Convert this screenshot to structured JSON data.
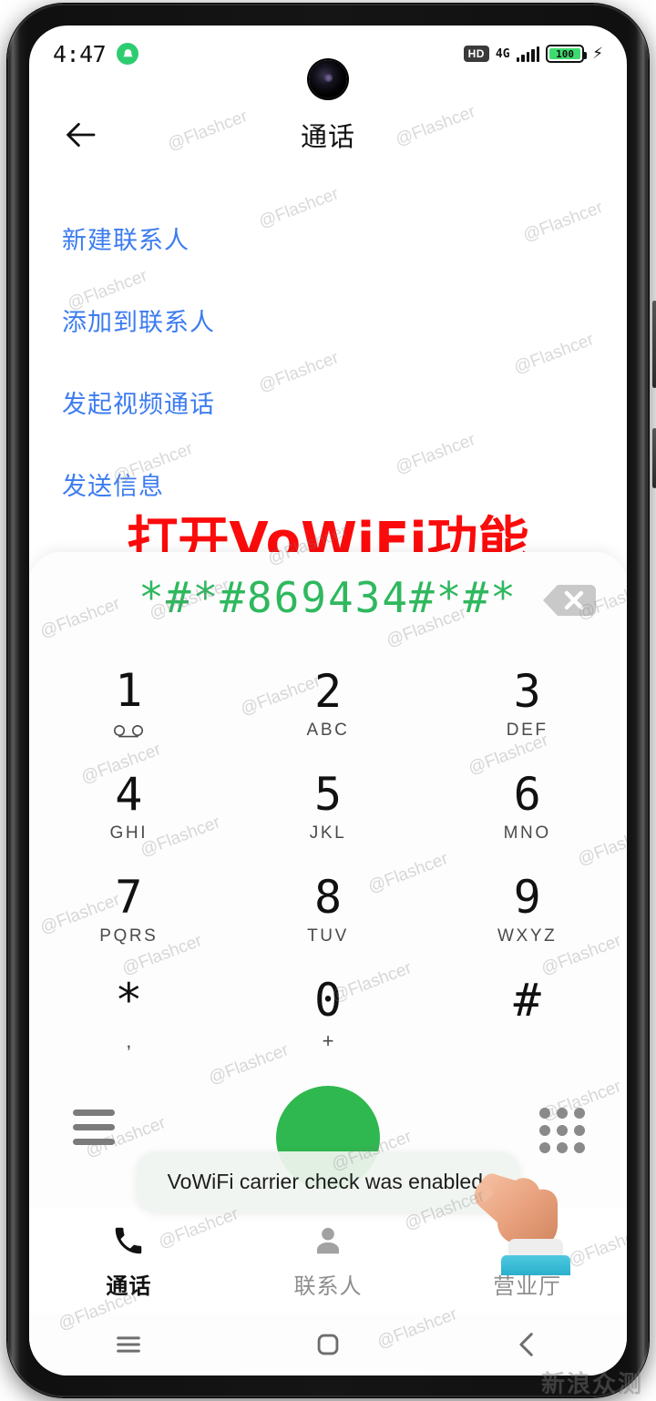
{
  "status_bar": {
    "clock": "4:47",
    "alarm_icon": "alarm-icon",
    "hd_badge": "HD",
    "network_type": "4G",
    "battery_level": "100",
    "charging_icon": "charging-bolt-icon"
  },
  "top_nav": {
    "back_icon": "back-arrow-icon",
    "title": "通话"
  },
  "context_menu": {
    "items": [
      {
        "label": "新建联系人"
      },
      {
        "label": "添加到联系人"
      },
      {
        "label": "发起视频通话"
      },
      {
        "label": "发送信息"
      }
    ]
  },
  "annotation": {
    "text": "打开VoWiFi功能",
    "color": "#fb0b0b"
  },
  "dialer": {
    "dialed_number": "*#*#869434#*#*",
    "number_color": "#2fb85e",
    "backspace_icon": "backspace-icon",
    "keys": [
      {
        "digit": "1",
        "sub": "",
        "icon": "voicemail-icon"
      },
      {
        "digit": "2",
        "sub": "ABC",
        "icon": ""
      },
      {
        "digit": "3",
        "sub": "DEF",
        "icon": ""
      },
      {
        "digit": "4",
        "sub": "GHI",
        "icon": ""
      },
      {
        "digit": "5",
        "sub": "JKL",
        "icon": ""
      },
      {
        "digit": "6",
        "sub": "MNO",
        "icon": ""
      },
      {
        "digit": "7",
        "sub": "PQRS",
        "icon": ""
      },
      {
        "digit": "8",
        "sub": "TUV",
        "icon": ""
      },
      {
        "digit": "9",
        "sub": "WXYZ",
        "icon": ""
      },
      {
        "digit": "*",
        "sub": ",",
        "icon": ""
      },
      {
        "digit": "0",
        "sub": "+",
        "icon": ""
      },
      {
        "digit": "#",
        "sub": "",
        "icon": ""
      }
    ],
    "menu_icon": "hamburger-menu-icon",
    "call_button_icon": "call-button",
    "call_button_color": "#2fb84f",
    "keypad_toggle_icon": "keypad-dots-icon"
  },
  "toast": {
    "message": "VoWiFi carrier check was enabled."
  },
  "cursor": {
    "icon": "pointing-hand-cursor"
  },
  "tab_bar": {
    "tabs": [
      {
        "label": "通话",
        "icon": "phone-icon",
        "active": true
      },
      {
        "label": "联系人",
        "icon": "person-icon",
        "active": false
      },
      {
        "label": "营业厅",
        "icon": "store-icon",
        "active": false
      }
    ]
  },
  "android_nav": {
    "recents_icon": "recents-icon",
    "home_icon": "home-icon",
    "back_icon": "back-chevron-icon"
  },
  "watermark": {
    "text": "@Flashcer",
    "logo": "新浪众测"
  }
}
